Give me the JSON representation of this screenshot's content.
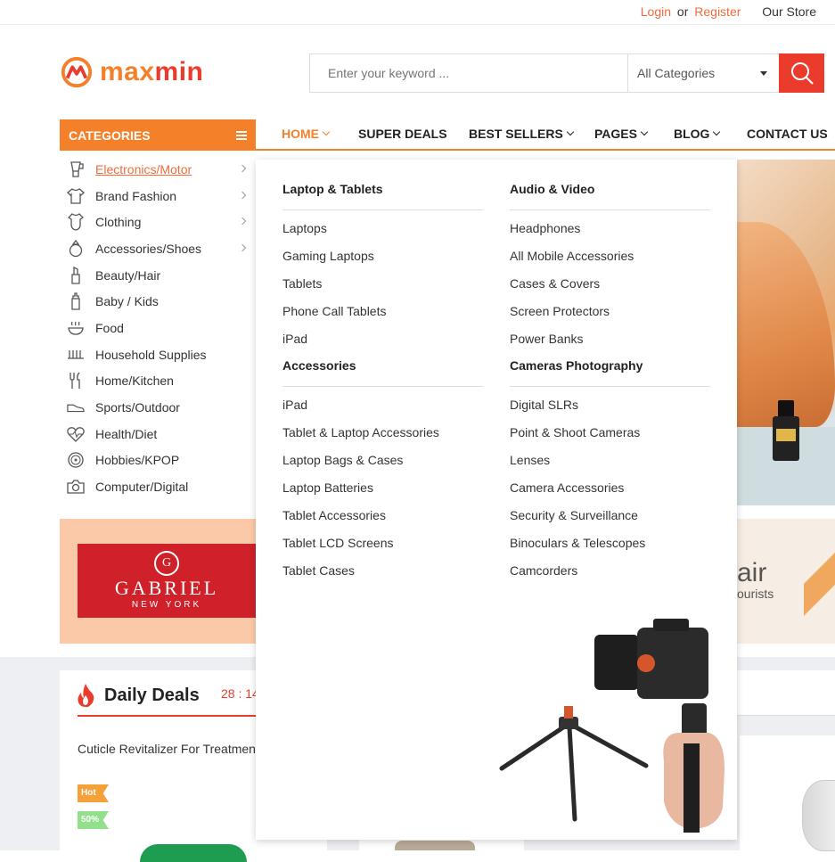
{
  "topbar": {
    "login": "Login",
    "or": "or",
    "register": "Register",
    "store": "Our Store"
  },
  "logo": {
    "text_a": "max",
    "text_b": "min",
    "color_a": "#f4812a",
    "color_b": "#ea3b2c"
  },
  "search": {
    "placeholder": "Enter your keyword ...",
    "category": "All Categories",
    "button_icon": "search-icon",
    "button_color": "#ea3b2c"
  },
  "categories": {
    "label": "CATEGORIES",
    "items": [
      {
        "label": "Electronics/Motor",
        "icon": "blender-icon",
        "arrow": true,
        "active": true
      },
      {
        "label": "Brand Fashion",
        "icon": "shirt-icon",
        "arrow": true
      },
      {
        "label": "Clothing",
        "icon": "baby-bodysuit-icon",
        "arrow": true
      },
      {
        "label": "Accessories/Shoes",
        "icon": "ring-icon",
        "arrow": true
      },
      {
        "label": "Beauty/Hair",
        "icon": "lipstick-icon"
      },
      {
        "label": "Baby / Kids",
        "icon": "baby-bottle-icon"
      },
      {
        "label": "Food",
        "icon": "food-bowl-icon"
      },
      {
        "label": "Household Supplies",
        "icon": "radiator-icon"
      },
      {
        "label": "Home/Kitchen",
        "icon": "utensils-icon"
      },
      {
        "label": "Sports/Outdoor",
        "icon": "sneaker-icon"
      },
      {
        "label": "Health/Diet",
        "icon": "heartbeat-icon"
      },
      {
        "label": "Hobbies/KPOP",
        "icon": "vinyl-record-icon"
      },
      {
        "label": "Computer/Digital",
        "icon": "camera-icon"
      }
    ]
  },
  "nav": {
    "items": [
      {
        "label": "HOME",
        "dropdown": true,
        "active": true
      },
      {
        "label": "SUPER DEALS"
      },
      {
        "label": "BEST SELLERS",
        "dropdown": true
      },
      {
        "label": "PAGES",
        "dropdown": true
      },
      {
        "label": "BLOG",
        "dropdown": true
      },
      {
        "label": "CONTACT US"
      }
    ]
  },
  "mega": {
    "left": [
      {
        "heading": "Laptop & Tablets",
        "items": [
          "Laptops",
          "Gaming Laptops",
          "Tablets",
          "Phone Call Tablets",
          "iPad"
        ]
      },
      {
        "heading": "Accessories",
        "items": [
          "iPad",
          "Tablet & Laptop Accessories",
          "Laptop Bags & Cases",
          "Laptop Batteries",
          "Tablet Accessories",
          "Tablet LCD Screens",
          "Tablet Cases"
        ]
      }
    ],
    "right": [
      {
        "heading": "Audio & Video",
        "items": [
          "Headphones",
          "All Mobile Accessories",
          "Cases & Covers",
          "Screen Protectors",
          "Power Banks"
        ]
      },
      {
        "heading": "Cameras Photography",
        "items": [
          "Digital SLRs",
          "Point & Shoot Cameras",
          "Lenses",
          "Camera Accessories",
          "Security & Surveillance",
          "Binoculars & Telescopes",
          "Camcorders"
        ]
      }
    ]
  },
  "banner": {
    "brand": "GABRIEL",
    "sub": "NEW YORK",
    "emblem": "G"
  },
  "banner2": {
    "t1": "air",
    "t2": "ourists"
  },
  "deals": {
    "title": "Daily Deals",
    "timer": "28 : 14",
    "product": "Cuticle Revitalizer For Treatment",
    "badge_hot": "Hot",
    "badge_pct": "50%"
  },
  "colors": {
    "accent": "#f4812a",
    "red": "#ea3b2c"
  }
}
